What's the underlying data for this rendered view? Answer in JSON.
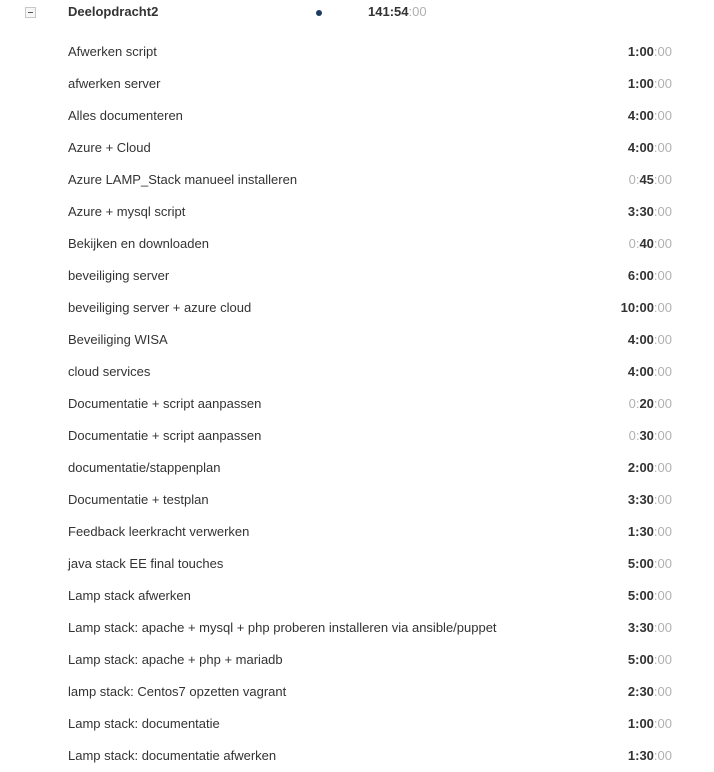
{
  "project": {
    "name": "Deelopdracht2",
    "total_main": "141:54",
    "total_secs": ":00"
  },
  "entries": [
    {
      "description": "Afwerken script",
      "dur_lead": "",
      "dur_main": "1:00",
      "dur_secs": ":00"
    },
    {
      "description": "afwerken server",
      "dur_lead": "",
      "dur_main": "1:00",
      "dur_secs": ":00"
    },
    {
      "description": "Alles documenteren",
      "dur_lead": "",
      "dur_main": "4:00",
      "dur_secs": ":00"
    },
    {
      "description": "Azure + Cloud",
      "dur_lead": "",
      "dur_main": "4:00",
      "dur_secs": ":00"
    },
    {
      "description": "Azure LAMP_Stack manueel installeren",
      "dur_lead": "0:",
      "dur_main": "45",
      "dur_secs": ":00"
    },
    {
      "description": "Azure + mysql script",
      "dur_lead": "",
      "dur_main": "3:30",
      "dur_secs": ":00"
    },
    {
      "description": "Bekijken en downloaden",
      "dur_lead": "0:",
      "dur_main": "40",
      "dur_secs": ":00"
    },
    {
      "description": "beveiliging server",
      "dur_lead": "",
      "dur_main": "6:00",
      "dur_secs": ":00"
    },
    {
      "description": "beveiliging server + azure cloud",
      "dur_lead": "",
      "dur_main": "10:00",
      "dur_secs": ":00"
    },
    {
      "description": "Beveiliging WISA",
      "dur_lead": "",
      "dur_main": "4:00",
      "dur_secs": ":00"
    },
    {
      "description": "cloud services",
      "dur_lead": "",
      "dur_main": "4:00",
      "dur_secs": ":00"
    },
    {
      "description": "Documentatie + script aanpassen",
      "dur_lead": "0:",
      "dur_main": "20",
      "dur_secs": ":00"
    },
    {
      "description": "Documentatie + script aanpassen",
      "dur_lead": "0:",
      "dur_main": "30",
      "dur_secs": ":00"
    },
    {
      "description": "documentatie/stappenplan",
      "dur_lead": "",
      "dur_main": "2:00",
      "dur_secs": ":00"
    },
    {
      "description": "Documentatie + testplan",
      "dur_lead": "",
      "dur_main": "3:30",
      "dur_secs": ":00"
    },
    {
      "description": "Feedback leerkracht verwerken",
      "dur_lead": "",
      "dur_main": "1:30",
      "dur_secs": ":00"
    },
    {
      "description": "java stack EE final touches",
      "dur_lead": "",
      "dur_main": "5:00",
      "dur_secs": ":00"
    },
    {
      "description": "Lamp stack afwerken",
      "dur_lead": "",
      "dur_main": "5:00",
      "dur_secs": ":00"
    },
    {
      "description": "Lamp stack: apache + mysql + php proberen installeren via ansible/puppet",
      "dur_lead": "",
      "dur_main": "3:30",
      "dur_secs": ":00"
    },
    {
      "description": "Lamp stack: apache + php + mariadb",
      "dur_lead": "",
      "dur_main": "5:00",
      "dur_secs": ":00"
    },
    {
      "description": "lamp stack: Centos7 opzetten vagrant",
      "dur_lead": "",
      "dur_main": "2:30",
      "dur_secs": ":00"
    },
    {
      "description": "Lamp stack: documentatie",
      "dur_lead": "",
      "dur_main": "1:00",
      "dur_secs": ":00"
    },
    {
      "description": "Lamp stack: documentatie afwerken",
      "dur_lead": "",
      "dur_main": "1:30",
      "dur_secs": ":00"
    }
  ]
}
